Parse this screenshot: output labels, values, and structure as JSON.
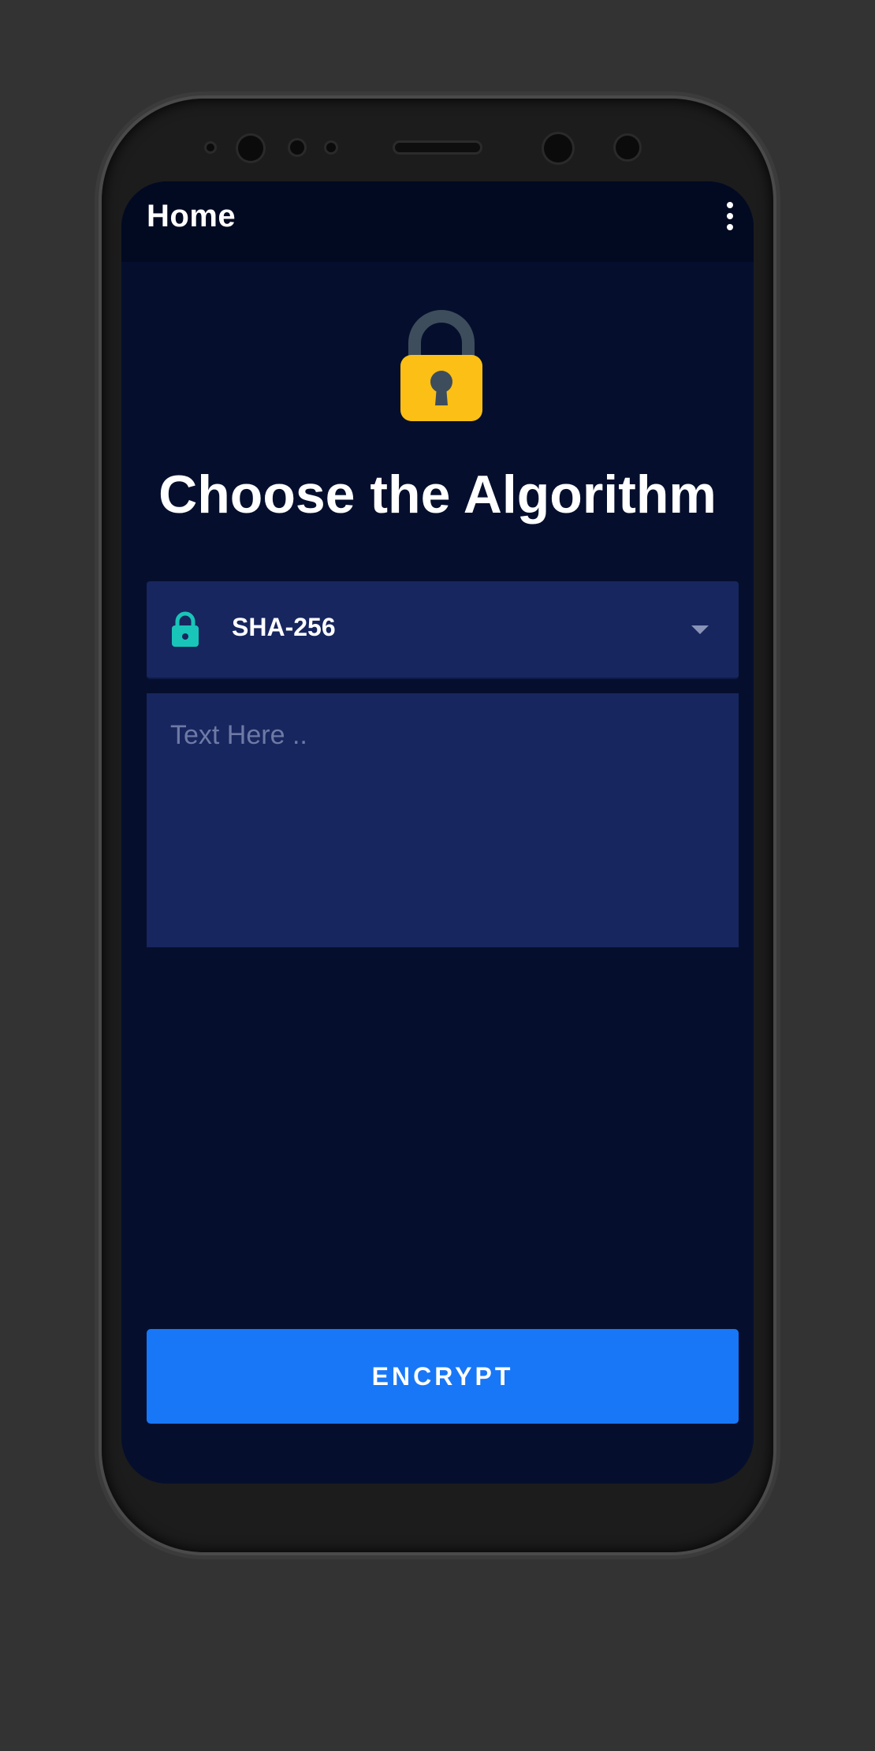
{
  "appbar": {
    "title": "Home",
    "menu_icon": "more-vert-icon"
  },
  "hero": {
    "icon": "padlock-icon",
    "heading": "Choose the Algorithm"
  },
  "algorithm_select": {
    "icon": "lock-icon",
    "selected_value": "SHA-256",
    "caret_icon": "dropdown-arrow-icon"
  },
  "input": {
    "placeholder": "Text Here ..",
    "value": ""
  },
  "actions": {
    "encrypt_label": "ENCRYPT"
  },
  "colors": {
    "background": "#050f2d",
    "appbar": "#020a22",
    "field": "#17265e",
    "accent": "#1877f6",
    "lock_body": "#fbbf16",
    "lock_shackle": "#3e4d5c",
    "select_icon": "#19c5b8"
  }
}
